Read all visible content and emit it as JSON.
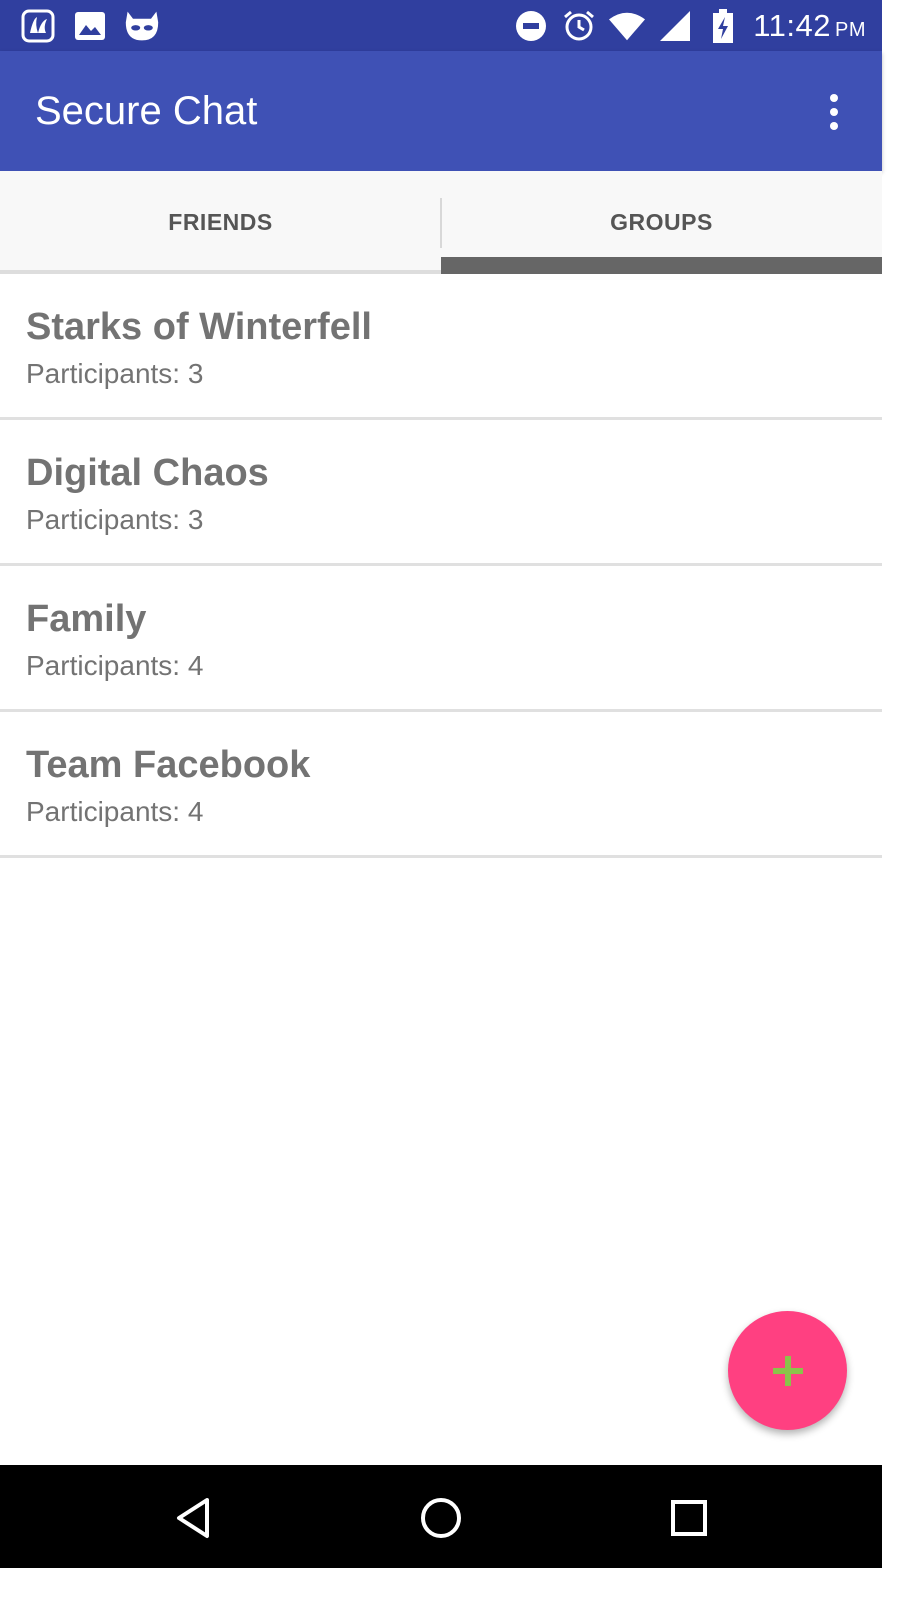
{
  "status_bar": {
    "time": "11:42",
    "ampm": "PM",
    "left_icons": [
      "saavn-icon",
      "image-icon",
      "cyanogen-cat-icon"
    ],
    "right_icons": [
      "do-not-disturb-icon",
      "alarm-icon",
      "wifi-icon",
      "signal-icon",
      "battery-charging-icon"
    ]
  },
  "app_bar": {
    "title": "Secure Chat",
    "overflow_icon": "more-vert-icon"
  },
  "tabs": [
    {
      "label": "FRIENDS",
      "selected": false
    },
    {
      "label": "GROUPS",
      "selected": true
    }
  ],
  "groups": [
    {
      "name": "Starks of Winterfell",
      "participants": "Participants: 3"
    },
    {
      "name": "Digital Chaos",
      "participants": "Participants: 3"
    },
    {
      "name": "Family",
      "participants": "Participants: 4"
    },
    {
      "name": "Team Facebook",
      "participants": "Participants: 4"
    }
  ],
  "fab": {
    "icon": "plus-icon",
    "color": "#ff4081",
    "icon_color": "#8bc34a"
  },
  "nav_bar": {
    "buttons": [
      "back-icon",
      "home-icon",
      "recents-icon"
    ]
  },
  "colors": {
    "status_bar": "#303f9f",
    "app_bar": "#3f51b5",
    "text_secondary": "#737373",
    "tab_indicator": "#666666"
  }
}
